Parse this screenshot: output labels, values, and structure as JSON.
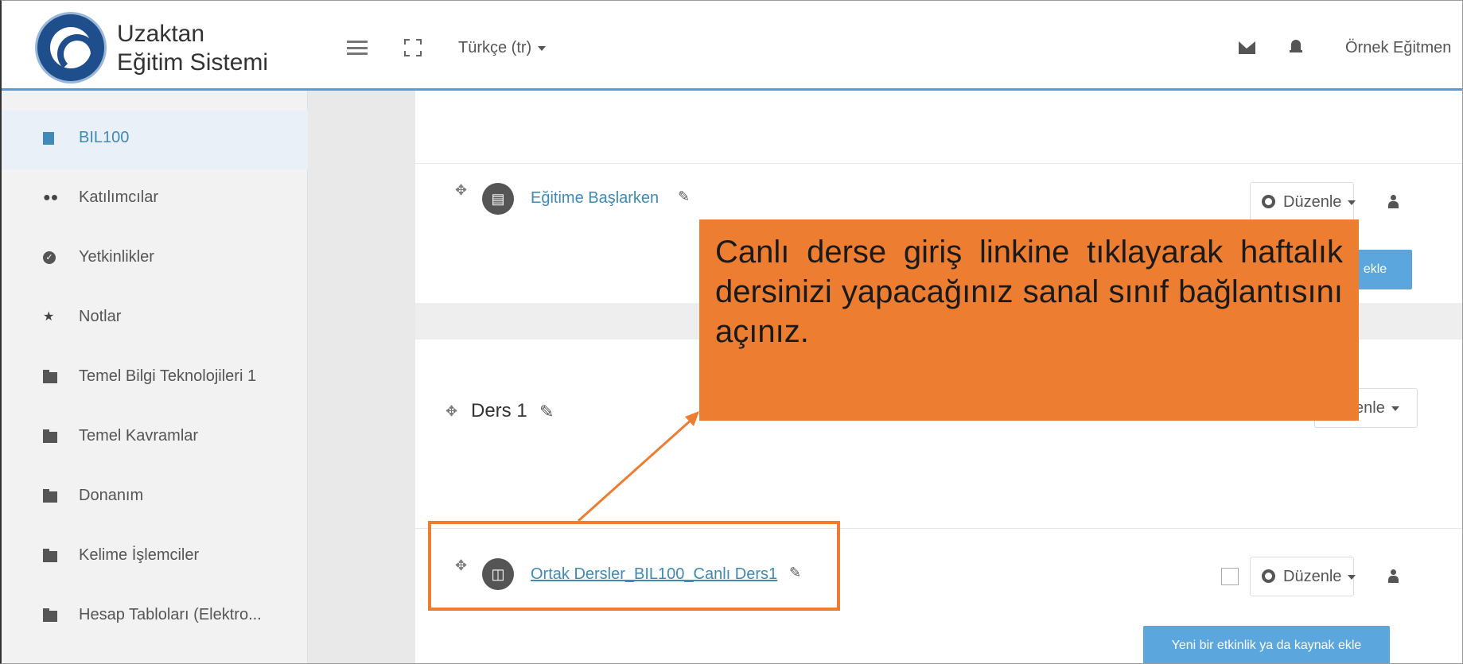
{
  "header": {
    "brand_line1": "Uzaktan",
    "brand_line2": "Eğitim Sistemi",
    "language": "Türkçe (tr)",
    "user_name": "Örnek Eğitmen"
  },
  "sidebar": {
    "items": [
      {
        "label": "BIL100",
        "icon": "book-icon"
      },
      {
        "label": "Katılımcılar",
        "icon": "users-icon"
      },
      {
        "label": "Yetkinlikler",
        "icon": "check-circle-icon"
      },
      {
        "label": "Notlar",
        "icon": "star-icon"
      },
      {
        "label": "Temel Bilgi Teknolojileri 1",
        "icon": "folder-icon"
      },
      {
        "label": "Temel Kavramlar",
        "icon": "folder-icon"
      },
      {
        "label": "Donanım",
        "icon": "folder-icon"
      },
      {
        "label": "Kelime İşlemciler",
        "icon": "folder-icon"
      },
      {
        "label": "Hesap Tabloları (Elektro..."
      }
    ]
  },
  "main": {
    "activity1": {
      "label": "Eğitime Başlarken",
      "icon": "document-icon"
    },
    "edit_label": "Düzenle",
    "add_label_partial": "ekle",
    "section_title": "Ders 1",
    "section_edit_partial": "zenle",
    "activity2": {
      "label": "Ortak Dersler_BIL100_Canlı Ders1",
      "icon": "presentation-icon"
    },
    "add_activity_label": "Yeni bir etkinlik ya da kaynak ekle"
  },
  "callout": {
    "text": "Canlı derse giriş linkine tıklayarak haftalık dersinizi yapacağınız sanal sınıf bağlantısını açınız."
  },
  "colors": {
    "accent": "#ed7d31",
    "link": "#3f8ab7",
    "button": "#5aa6dd"
  }
}
